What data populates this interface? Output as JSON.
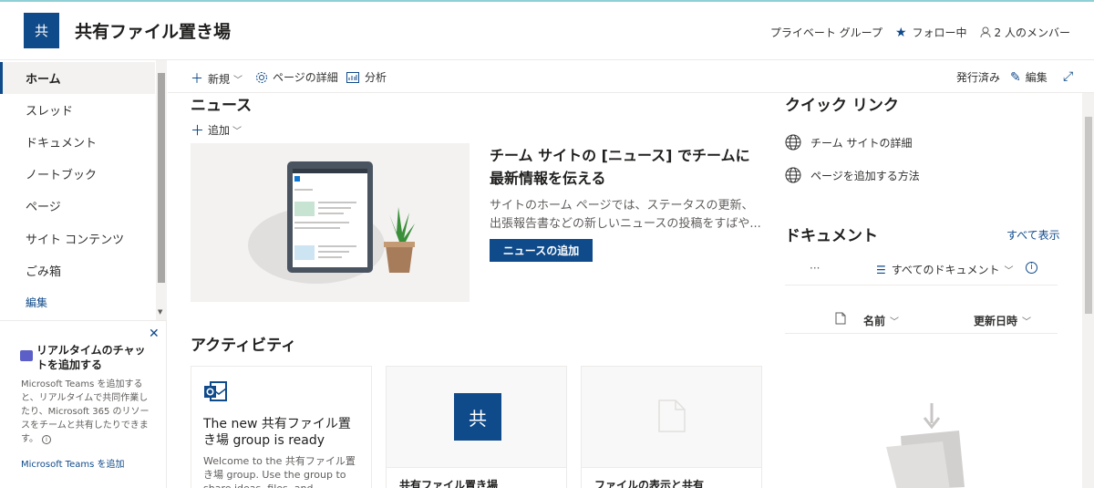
{
  "site": {
    "logo_text": "共",
    "title": "共有ファイル置き場",
    "privacy": "プライベート グループ",
    "follow": "フォロー中",
    "members": "2 人のメンバー"
  },
  "nav": {
    "items": [
      "ホーム",
      "スレッド",
      "ドキュメント",
      "ノートブック",
      "ページ",
      "サイト コンテンツ",
      "ごみ箱"
    ],
    "edit": "編集",
    "active_index": 0
  },
  "promo": {
    "title": "リアルタイムのチャットを追加する",
    "description": "Microsoft Teams を追加すると、リアルタイムで共同作業したり、Microsoft 365 のリソースをチームと共有したりできます。",
    "link": "Microsoft Teams を追加"
  },
  "commandbar": {
    "new": "新規",
    "page_details": "ページの詳細",
    "analytics": "分析",
    "status": "発行済み",
    "edit": "編集"
  },
  "news": {
    "title": "ニュース",
    "add": "追加",
    "headline": "チーム サイトの [ニュース] でチームに最新情報を伝える",
    "description": "サイトのホーム ページでは、ステータスの更新、出張報告書などの新しいニュースの投稿をすばや...",
    "button": "ニュースの追加"
  },
  "activity": {
    "title": "アクティビティ",
    "cards": [
      {
        "title": "The new 共有ファイル置き場 group is ready",
        "description": "Welcome to the 共有ファイル置き場 group. Use the group to share ideas, files, and important"
      },
      {
        "logo": "共",
        "footer": "共有ファイル置き場"
      },
      {
        "footer": "ファイルの表示と共有"
      }
    ]
  },
  "quicklinks": {
    "title": "クイック リンク",
    "items": [
      "チーム サイトの詳細",
      "ページを追加する方法"
    ]
  },
  "documents": {
    "title": "ドキュメント",
    "see_all": "すべて表示",
    "more": "···",
    "view": "すべてのドキュメント",
    "col_name": "名前",
    "col_modified": "更新日時"
  },
  "colors": {
    "accent": "#0f4a8a",
    "teams": "#5b5fc7"
  }
}
